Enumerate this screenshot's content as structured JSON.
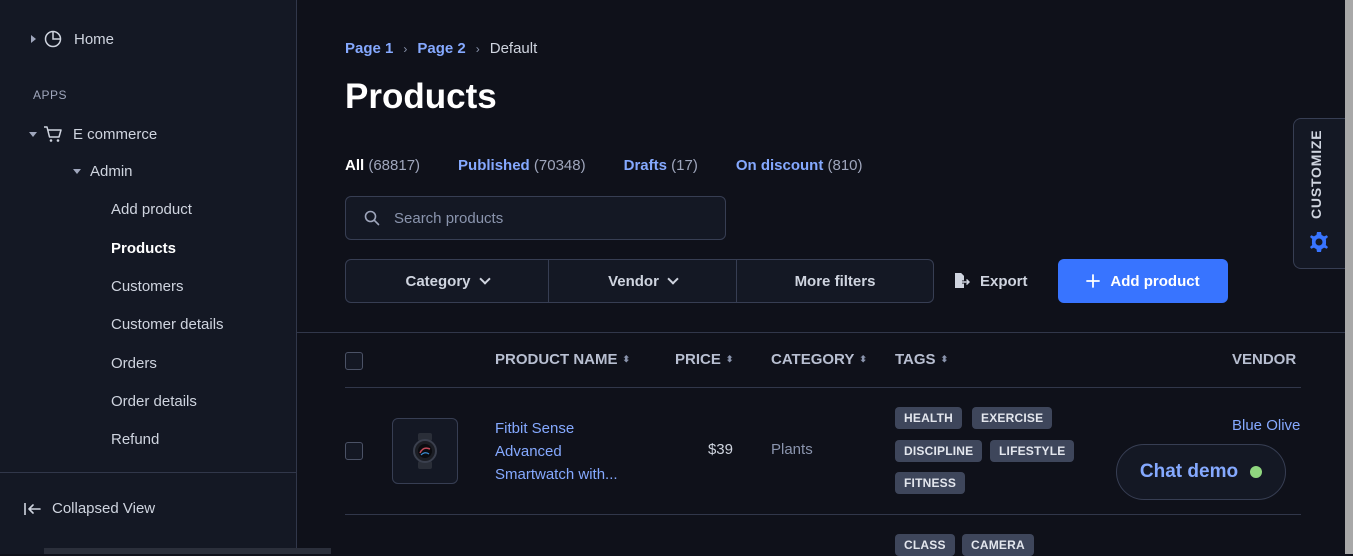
{
  "sidebar": {
    "home_label": "Home",
    "section_label": "APPS",
    "ecommerce_label": "E commerce",
    "admin_label": "Admin",
    "items": [
      {
        "label": "Add product"
      },
      {
        "label": "Products"
      },
      {
        "label": "Customers"
      },
      {
        "label": "Customer details"
      },
      {
        "label": "Orders"
      },
      {
        "label": "Order details"
      },
      {
        "label": "Refund"
      }
    ],
    "collapsed_label": "Collapsed View"
  },
  "breadcrumb": {
    "page1": "Page 1",
    "page2": "Page 2",
    "current": "Default"
  },
  "page_title": "Products",
  "status_tabs": [
    {
      "label": "All",
      "count": "(68817)"
    },
    {
      "label": "Published",
      "count": "(70348)"
    },
    {
      "label": "Drafts",
      "count": "(17)"
    },
    {
      "label": "On discount",
      "count": "(810)"
    }
  ],
  "search": {
    "placeholder": "Search products"
  },
  "filters": {
    "category": "Category",
    "vendor": "Vendor",
    "more": "More filters"
  },
  "toolbar": {
    "export_label": "Export",
    "add_label": "Add product"
  },
  "table": {
    "headers": {
      "name": "PRODUCT NAME",
      "price": "PRICE",
      "category": "CATEGORY",
      "tags": "TAGS",
      "vendor": "VENDOR"
    },
    "row1": {
      "name": "Fitbit Sense Advanced Smartwatch with...",
      "price": "$39",
      "category": "Plants",
      "tags": [
        "HEALTH",
        "EXERCISE",
        "DISCIPLINE",
        "LIFESTYLE",
        "FITNESS"
      ],
      "vendor": "Blue Olive"
    },
    "row2": {
      "tags": [
        "CLASS",
        "CAMERA"
      ]
    }
  },
  "customize_label": "CUSTOMIZE",
  "chat": {
    "label": "Chat demo"
  },
  "colors": {
    "accent": "#3874ff",
    "link": "#85a9ff",
    "online": "#90d67f"
  }
}
